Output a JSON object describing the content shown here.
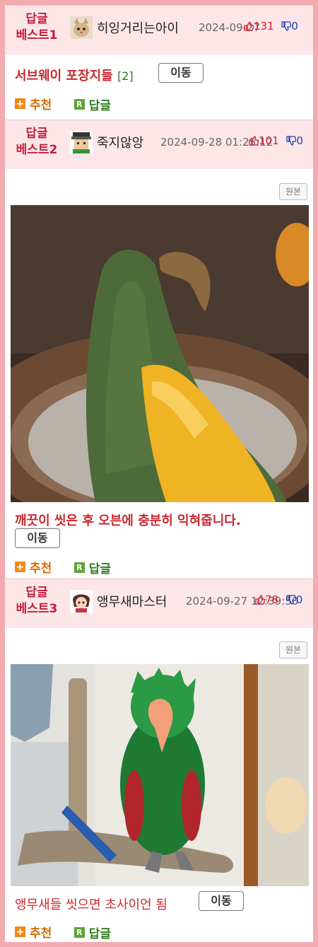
{
  "posts": [
    {
      "best_label_1": "답글",
      "best_label_2": "베스트1",
      "author": "히잉거리는아이",
      "avatar_icon": "cat-avatar-icon",
      "date": "2024-09-27",
      "up": "131",
      "down": "0",
      "title": "서브웨이 포장지들",
      "comment_count": "[2]",
      "move_label": "이동",
      "recommend_label": "추천",
      "reply_label": "답글"
    },
    {
      "best_label_1": "답글",
      "best_label_2": "베스트2",
      "author": "죽지않앙",
      "avatar_icon": "pixel-avatar-icon",
      "date": "2024-09-28 01:25:12",
      "up": "101",
      "down": "0",
      "original_label": "원본",
      "image_desc": "papaya-parrot-photo",
      "title": "깨끗이 씻은 후 오븐에 충분히 익혀줍니다.",
      "move_label": "이동",
      "recommend_label": "추천",
      "reply_label": "답글"
    },
    {
      "best_label_1": "답글",
      "best_label_2": "베스트3",
      "author": "앵무새마스터",
      "avatar_icon": "character-avatar-icon",
      "date": "2024-09-27 12:39:50",
      "up": "78",
      "down": "0",
      "original_label": "원본",
      "image_desc": "wet-green-parrot-photo",
      "title": "앵무새들 씻으면 초사이언 됨",
      "move_label": "이동",
      "recommend_label": "추천",
      "reply_label": "답글"
    }
  ],
  "colors": {
    "border": "#f4aab1",
    "header_bg": "#fde6e8",
    "best_label": "#c21e3a",
    "title": "#c8292f",
    "upvote": "#d32237",
    "downvote": "#1b3dba",
    "recommend": "#d46a00",
    "reply": "#2f7d1f"
  }
}
